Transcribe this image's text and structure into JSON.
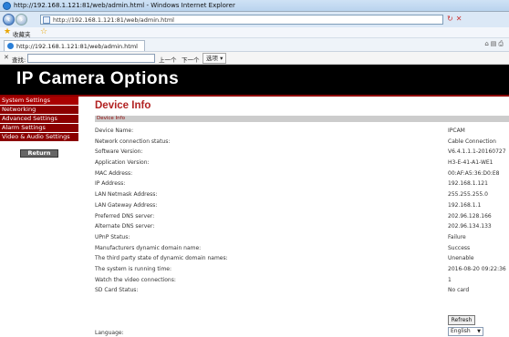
{
  "browser": {
    "window_title": "http://192.168.1.121:81/web/admin.html - Windows Internet Explorer",
    "address": "http://192.168.1.121:81/web/admin.html",
    "favorites_label": "收藏夹",
    "tab_title": "http://192.168.1.121:81/web/admin.html",
    "find_label": "查找:",
    "find_value": "",
    "find_prev": "上一个",
    "find_next": "下一个",
    "find_options": "选项 ▾"
  },
  "header": {
    "title": "IP Camera Options"
  },
  "sidebar": {
    "items": [
      {
        "label": "System Settings"
      },
      {
        "label": "Networking"
      },
      {
        "label": "Advanced Settings"
      },
      {
        "label": "Alarm Settings"
      },
      {
        "label": "Video & Audio Settings"
      }
    ],
    "return_label": "Return"
  },
  "main": {
    "title": "Device Info",
    "section_label": "Device Info",
    "rows": [
      {
        "label": "Device Name:",
        "value": "IPCAM"
      },
      {
        "label": "Network connection status:",
        "value": "Cable Connection"
      },
      {
        "label": "Software Version:",
        "value": "V6.4.1.1.1-20160727"
      },
      {
        "label": "Application Version:",
        "value": "H3-E-41-A1-WE1"
      },
      {
        "label": "MAC Address:",
        "value": "00:AF:A5:36:D0:E8"
      },
      {
        "label": "IP Address:",
        "value": "192.168.1.121"
      },
      {
        "label": "LAN Netmask Address:",
        "value": "255.255.255.0"
      },
      {
        "label": "LAN Gateway Address:",
        "value": "192.168.1.1"
      },
      {
        "label": "Preferred DNS server:",
        "value": "202.96.128.166"
      },
      {
        "label": "Alternate DNS server:",
        "value": "202.96.134.133"
      },
      {
        "label": "UPnP Status:",
        "value": "Failure"
      },
      {
        "label": "Manufacturers dynamic domain name:",
        "value": "Success"
      },
      {
        "label": "The third party state of dynamic domain names:",
        "value": "Unenable"
      },
      {
        "label": "The system is running time:",
        "value": "2016-08-20 09:22:36"
      },
      {
        "label": "Watch the video connections:",
        "value": "1"
      },
      {
        "label": "SD Card Status:",
        "value": "No card"
      }
    ],
    "language_label": "Language:",
    "language_value": "English",
    "refresh_label": "Refresh"
  },
  "colors": {
    "header_bg": "#000000",
    "accent": "#8b0000",
    "title_red": "#b22222"
  }
}
